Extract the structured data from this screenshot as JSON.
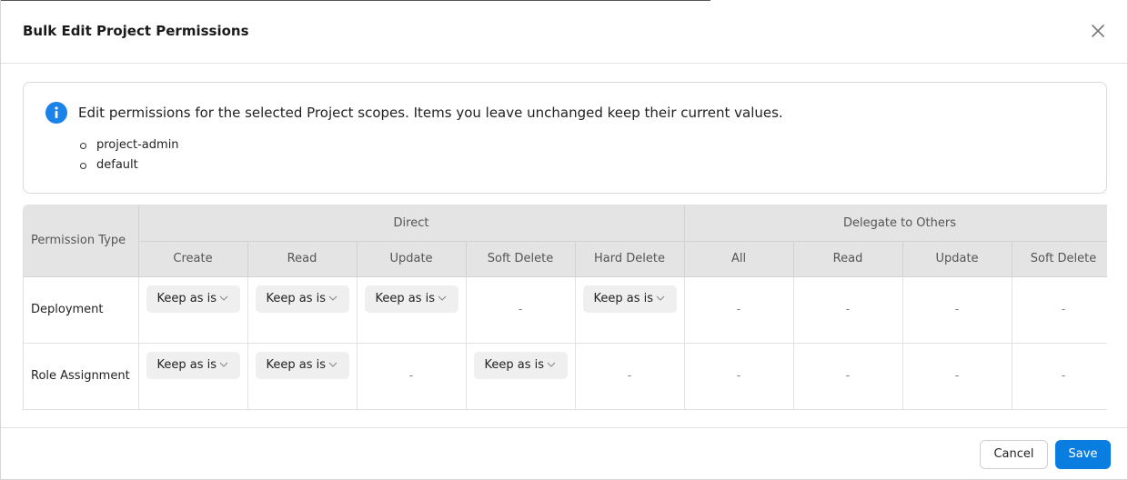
{
  "dialog": {
    "title": "Bulk Edit Project Permissions",
    "close_icon": "close-icon"
  },
  "info": {
    "icon": "info-icon",
    "message": "Edit permissions for the selected Project scopes. Items you leave unchanged keep their current values.",
    "scopes": [
      "project-admin",
      "default"
    ]
  },
  "table": {
    "first_col_header": "Permission Type",
    "groups": [
      "Direct",
      "Delegate to Others"
    ],
    "columns": [
      "Create",
      "Read",
      "Update",
      "Soft Delete",
      "Hard Delete",
      "All",
      "Read",
      "Update",
      "Soft Delete"
    ],
    "rows": [
      {
        "label": "Deployment",
        "cells": [
          "Keep as is",
          "Keep as is",
          "Keep as is",
          "-",
          "Keep as is",
          "-",
          "-",
          "-",
          "-"
        ]
      },
      {
        "label": "Role Assignment",
        "cells": [
          "Keep as is",
          "Keep as is",
          "-",
          "Keep as is",
          "-",
          "-",
          "-",
          "-",
          "-"
        ]
      }
    ]
  },
  "footer": {
    "cancel_label": "Cancel",
    "save_label": "Save"
  },
  "colors": {
    "accent": "#0a7ee0",
    "info": "#1a82e8"
  }
}
